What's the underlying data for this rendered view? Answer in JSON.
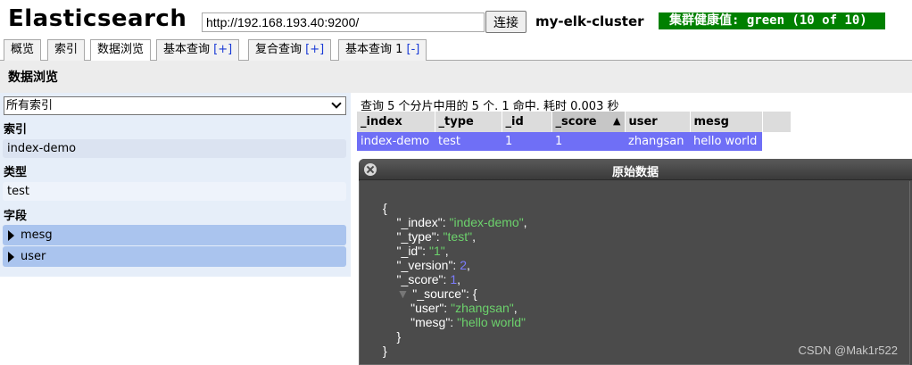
{
  "header": {
    "app_title": "Elasticsearch",
    "url": "http://192.168.193.40:9200/",
    "connect_label": "连接",
    "cluster_name": "my-elk-cluster",
    "health_text": "集群健康值: green (10 of 10)",
    "health_color": "#008000"
  },
  "tabs": [
    {
      "label": "概览",
      "suffix": ""
    },
    {
      "label": "索引",
      "suffix": ""
    },
    {
      "label": "数据浏览",
      "suffix": ""
    },
    {
      "label": "基本查询",
      "suffix": "[+]"
    },
    {
      "label": "复合查询",
      "suffix": "[+]"
    },
    {
      "label": "基本查询 1",
      "suffix": "[-]"
    }
  ],
  "page": {
    "title": "数据浏览"
  },
  "sidebar": {
    "index_select_value": "所有索引",
    "section_index": "索引",
    "index_items": [
      "index-demo"
    ],
    "section_type": "类型",
    "type_items": [
      "test"
    ],
    "section_fields": "字段",
    "field_items": [
      "mesg",
      "user"
    ]
  },
  "results": {
    "summary": "查询 5 个分片中用的 5 个. 1 命中. 耗时 0.003 秒",
    "columns": [
      "_index",
      "_type",
      "_id",
      "_score",
      "user",
      "mesg"
    ],
    "sort_indicator": "▲",
    "rows": [
      [
        "index-demo",
        "test",
        "1",
        "1",
        "zhangsan",
        "hello world"
      ]
    ],
    "row_color": "#6f6ff6"
  },
  "modal": {
    "title": "原始数据",
    "json": {
      "_index": "index-demo",
      "_type": "test",
      "_id": "1",
      "_version": "2",
      "_score": "1",
      "_source": {
        "user": "zhangsan",
        "mesg": "hello world"
      }
    }
  },
  "watermark": "CSDN @Mak1r522"
}
